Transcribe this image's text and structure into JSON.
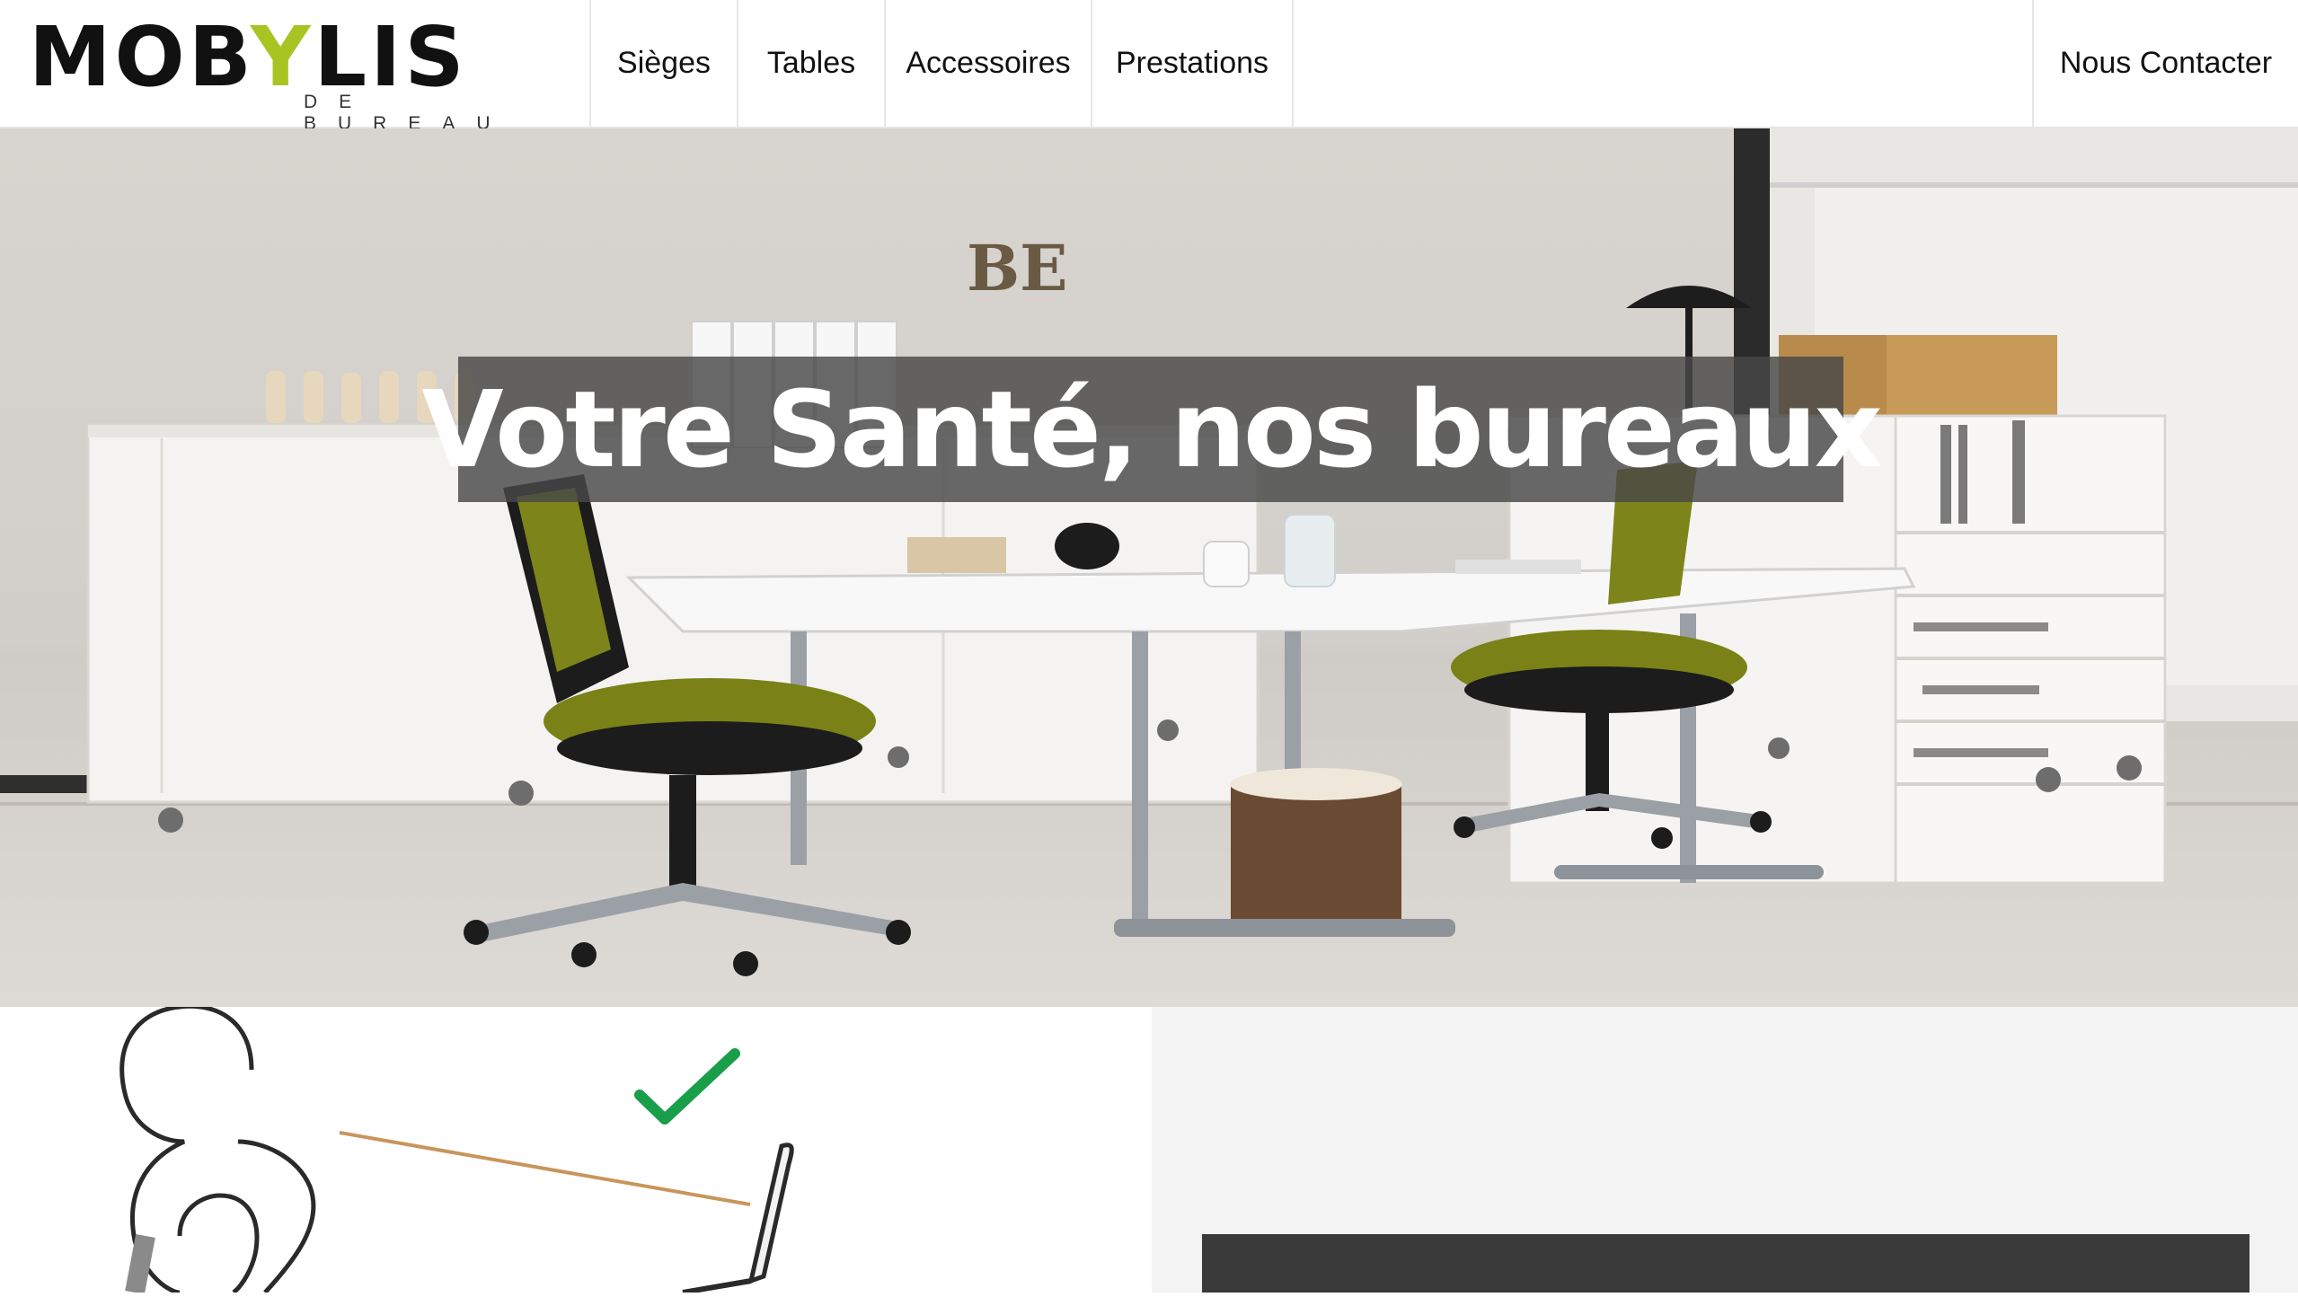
{
  "brand": {
    "logo_pre": "MOB",
    "logo_y": "Y",
    "logo_post": "LIS",
    "tagline": "DE BUREAU",
    "accent_color": "#a8c422"
  },
  "nav": {
    "items": [
      {
        "label": "Sièges"
      },
      {
        "label": "Tables"
      },
      {
        "label": "Accessoires"
      },
      {
        "label": "Prestations"
      }
    ],
    "contact_label": "Nous Contacter"
  },
  "hero": {
    "title": "Votre Santé, nos bureaux",
    "wall_letters": "BE"
  },
  "lower": {
    "illustration_icons": [
      "person-outline-icon",
      "laptop-icon",
      "checkmark-icon"
    ],
    "check_color": "#1a9e4a"
  }
}
